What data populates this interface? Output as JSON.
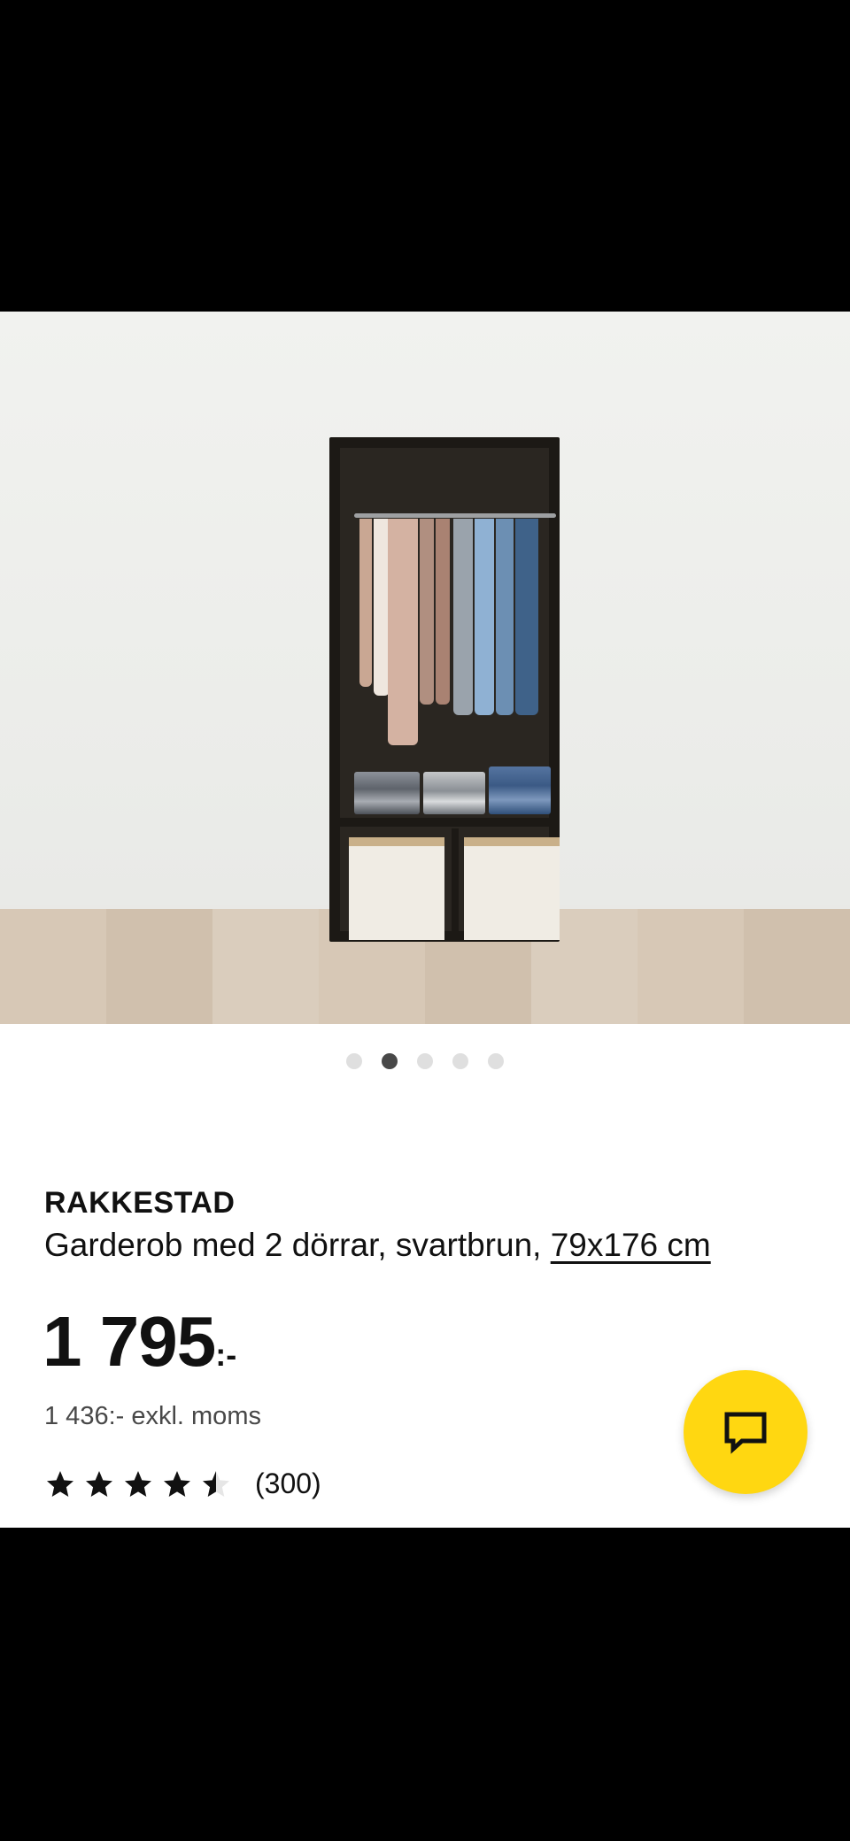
{
  "gallery": {
    "image_alt": "RAKKESTAD wardrobe photo",
    "dots": [
      {
        "active": false
      },
      {
        "active": true
      },
      {
        "active": false
      },
      {
        "active": false
      },
      {
        "active": false
      }
    ]
  },
  "product": {
    "name": "RAKKESTAD",
    "description": "Garderob med 2 dörrar, svartbrun, ",
    "size_link": "79x176 cm",
    "price_number": "1 795",
    "price_suffix": ":-",
    "price_excl_vat": "1 436:- exkl. moms",
    "rating_value": 4.5,
    "rating_max": 5,
    "review_count": "(300)"
  },
  "chat_button": {
    "icon": "chat-bubble-icon"
  },
  "colors": {
    "accent_yellow": "#ffd711",
    "text": "#111111",
    "muted_text": "#484848",
    "dot_active": "#484848",
    "dot_inactive": "#dfdfdf"
  }
}
